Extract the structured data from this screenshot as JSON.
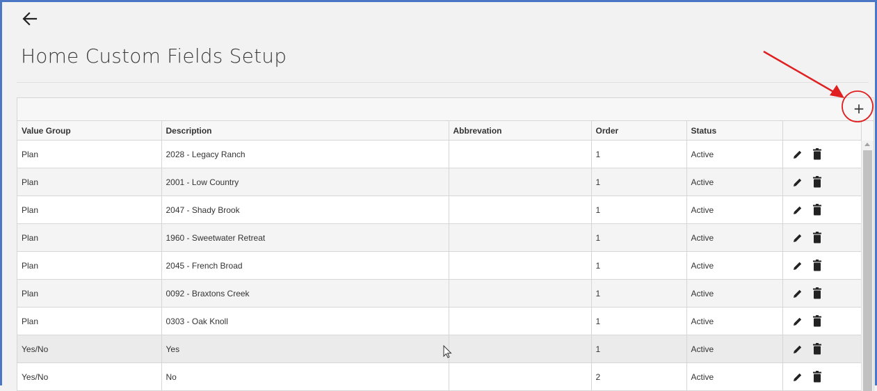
{
  "page": {
    "title": "Home Custom Fields Setup"
  },
  "icons": {
    "back": "arrow-left-icon",
    "add": "plus-icon",
    "edit": "pencil-icon",
    "delete": "trash-icon"
  },
  "colors": {
    "frame": "#4a76c4",
    "annotation": "#e02020"
  },
  "toolbar": {
    "add_label": "+"
  },
  "table": {
    "columns": [
      "Value Group",
      "Description",
      "Abbrevation",
      "Order",
      "Status",
      ""
    ],
    "rows": [
      {
        "value_group": "Plan",
        "description": "2028 - Legacy Ranch",
        "abbreviation": "",
        "order": "1",
        "status": "Active"
      },
      {
        "value_group": "Plan",
        "description": "2001 - Low Country",
        "abbreviation": "",
        "order": "1",
        "status": "Active"
      },
      {
        "value_group": "Plan",
        "description": "2047 - Shady Brook",
        "abbreviation": "",
        "order": "1",
        "status": "Active"
      },
      {
        "value_group": "Plan",
        "description": "1960 - Sweetwater Retreat",
        "abbreviation": "",
        "order": "1",
        "status": "Active"
      },
      {
        "value_group": "Plan",
        "description": "2045 - French Broad",
        "abbreviation": "",
        "order": "1",
        "status": "Active"
      },
      {
        "value_group": "Plan",
        "description": "0092 - Braxtons Creek",
        "abbreviation": "",
        "order": "1",
        "status": "Active"
      },
      {
        "value_group": "Plan",
        "description": "0303 - Oak Knoll",
        "abbreviation": "",
        "order": "1",
        "status": "Active"
      },
      {
        "value_group": "Yes/No",
        "description": "Yes",
        "abbreviation": "",
        "order": "1",
        "status": "Active"
      },
      {
        "value_group": "Yes/No",
        "description": "No",
        "abbreviation": "",
        "order": "2",
        "status": "Active"
      }
    ]
  }
}
